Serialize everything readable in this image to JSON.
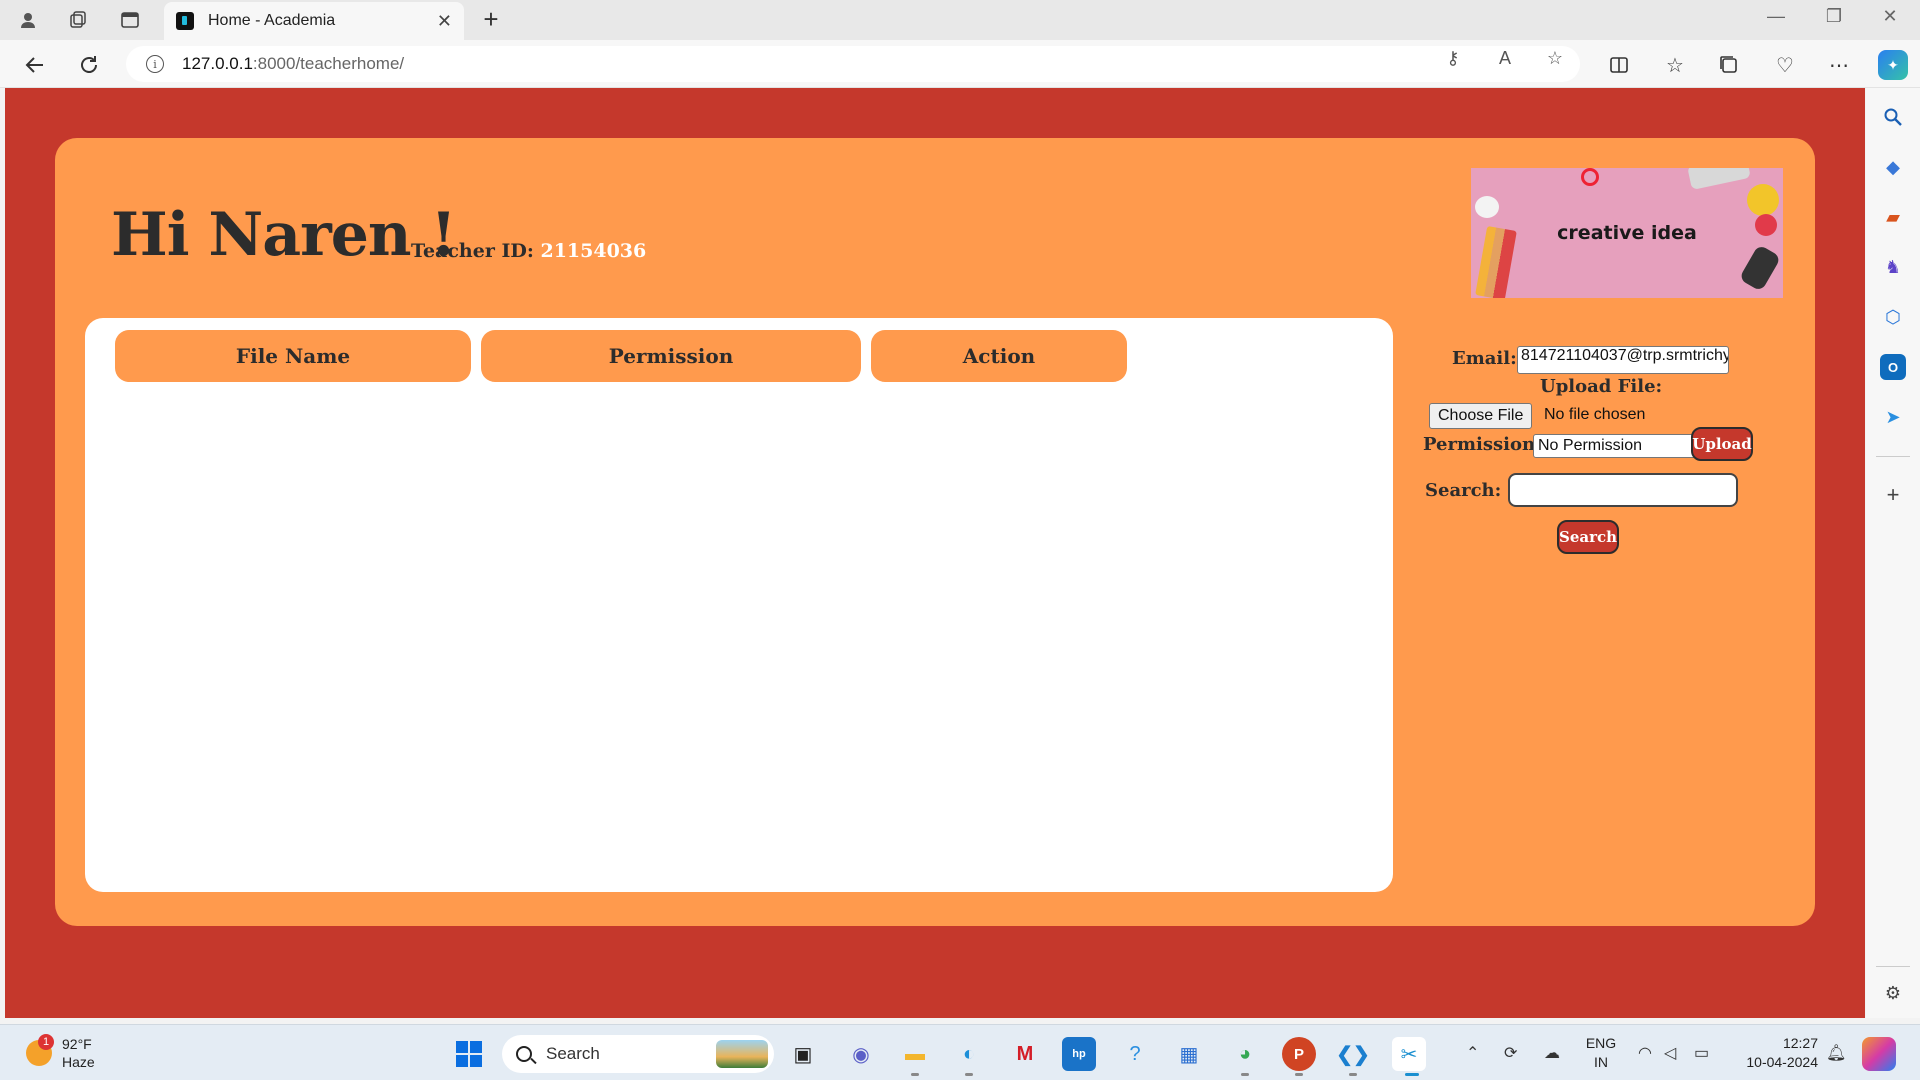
{
  "browser": {
    "tab_title": "Home - Academia",
    "url_host": "127.0.0.1",
    "url_path": ":8000/teacherhome/"
  },
  "page": {
    "greeting": "Hi Naren !",
    "teacher_id_label": "Teacher ID:",
    "teacher_id_value": "21154036",
    "banner_text": "creative idea",
    "table_headers": [
      "File Name",
      "Permission",
      "Action"
    ],
    "form": {
      "email_label": "Email:",
      "email_value": "814721104037@trp.srmtrichy",
      "upload_file_label": "Upload File:",
      "choose_file_button": "Choose File",
      "file_status": "No file chosen",
      "permission_label": "Permission:",
      "permission_selected": "No Permission",
      "upload_button": "Upload",
      "search_label": "Search:",
      "search_value": "",
      "search_button": "Search"
    }
  },
  "taskbar": {
    "weather_temp": "92°F",
    "weather_desc": "Haze",
    "weather_badge": "1",
    "search_label": "Search",
    "lang_top": "ENG",
    "lang_bottom": "IN",
    "time": "12:27",
    "date": "10-04-2024"
  },
  "colors": {
    "page_bg": "#c5382c",
    "card_bg": "#ff9a4d",
    "text_dark": "#2c2c2c",
    "button_bg": "#c5382c"
  }
}
